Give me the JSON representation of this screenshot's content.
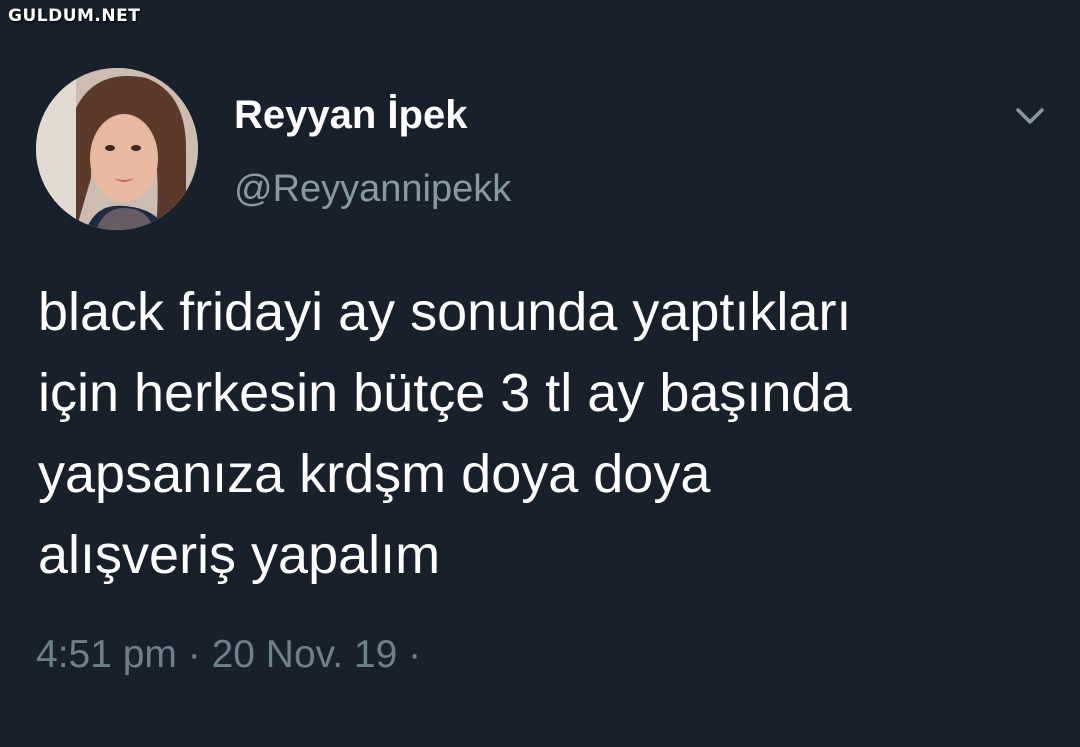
{
  "watermark": "GULDUM.NET",
  "tweet": {
    "display_name": "Reyyan İpek",
    "handle": "@Reyyannipekk",
    "text_lines": [
      "black fridayi ay sonunda yaptıkları",
      "için herkesin bütçe 3 tl ay başında",
      "yapsanıza krdşm doya doya",
      "alışveriş yapalım"
    ],
    "meta": "4:51 pm · 20 Nov. 19 ·"
  },
  "icons": {
    "menu": "chevron-down-icon",
    "avatar": "avatar"
  },
  "colors": {
    "background": "#18202b",
    "text_primary": "#ffffff",
    "text_secondary": "#8899a6",
    "meta": "#6e7f8d"
  }
}
